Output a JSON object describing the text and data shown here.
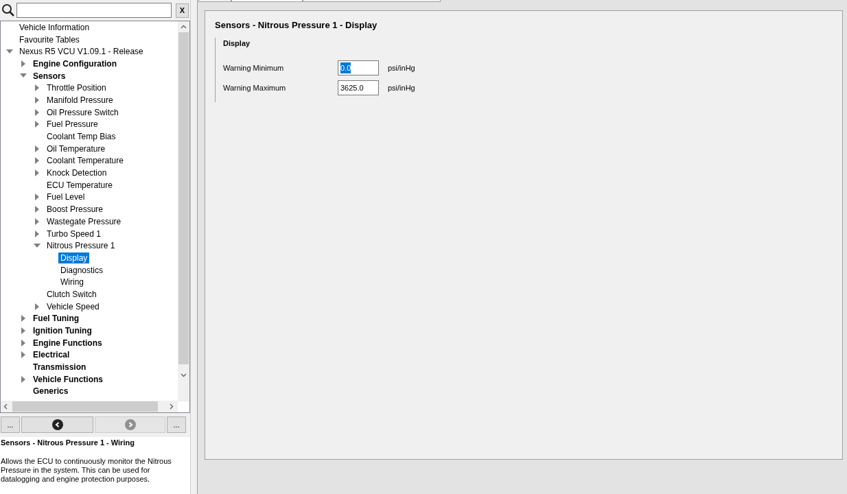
{
  "search": {
    "clear_button": "X"
  },
  "tree": [
    {
      "label": "Vehicle Information",
      "selected": false
    },
    {
      "label": "Favourite Tables",
      "selected": false
    },
    {
      "label": "Nexus R5 VCU V1.09.1 - Release",
      "selected": false,
      "expanded": true,
      "children": [
        {
          "label": "Engine Configuration",
          "selected": false,
          "expanded": false
        },
        {
          "label": "Sensors",
          "selected": false,
          "expanded": true,
          "children": [
            {
              "label": "Throttle Position",
              "selected": false,
              "expanded": false
            },
            {
              "label": "Manifold Pressure",
              "selected": false,
              "expanded": false
            },
            {
              "label": "Oil Pressure Switch",
              "selected": false,
              "expanded": false
            },
            {
              "label": "Fuel Pressure",
              "selected": false,
              "expanded": false
            },
            {
              "label": "Coolant Temp Bias",
              "selected": false
            },
            {
              "label": "Oil Temperature",
              "selected": false,
              "expanded": false
            },
            {
              "label": "Coolant Temperature",
              "selected": false,
              "expanded": false
            },
            {
              "label": "Knock Detection",
              "selected": false,
              "expanded": false
            },
            {
              "label": "ECU Temperature",
              "selected": false
            },
            {
              "label": "Fuel Level",
              "selected": false,
              "expanded": false
            },
            {
              "label": "Boost Pressure",
              "selected": false,
              "expanded": false
            },
            {
              "label": "Wastegate Pressure",
              "selected": false,
              "expanded": false
            },
            {
              "label": "Turbo Speed 1",
              "selected": false,
              "expanded": false
            },
            {
              "label": "Nitrous Pressure 1",
              "selected": false,
              "expanded": true,
              "children": [
                {
                  "label": "Display",
                  "selected": true
                },
                {
                  "label": "Diagnostics",
                  "selected": false
                },
                {
                  "label": "Wiring",
                  "selected": false
                }
              ]
            },
            {
              "label": "Clutch Switch",
              "selected": false
            },
            {
              "label": "Vehicle Speed",
              "selected": false,
              "expanded": false
            }
          ]
        },
        {
          "label": "Fuel Tuning",
          "selected": false,
          "expanded": false
        },
        {
          "label": "Ignition Tuning",
          "selected": false,
          "expanded": false
        },
        {
          "label": "Engine Functions",
          "selected": false,
          "expanded": false
        },
        {
          "label": "Electrical",
          "selected": false,
          "expanded": false
        },
        {
          "label": "Transmission",
          "selected": false
        },
        {
          "label": "Vehicle Functions",
          "selected": false,
          "expanded": false
        },
        {
          "label": "Generics",
          "selected": false
        }
      ]
    }
  ],
  "nav": {
    "left_more": "...",
    "right_more": "...",
    "back_disabled": false,
    "forward_disabled": true
  },
  "description": {
    "title": "Sensors - Nitrous Pressure 1 - Wiring",
    "text": "Allows the ECU to continuously monitor the Nitrous Pressure in the system. This can be used for datalogging and engine protection purposes."
  },
  "tabs": [
    {
      "selected": false
    },
    {
      "selected": true
    },
    {
      "selected": false
    }
  ],
  "page": {
    "title": "Sensors - Nitrous Pressure 1 - Display",
    "group": "Display",
    "fields": [
      {
        "label": "Warning Minimum",
        "value": "0.0",
        "text_selected": true,
        "unit": "psi/inHg"
      },
      {
        "label": "Warning Maximum",
        "value": "3625.0",
        "text_selected": false,
        "unit": "psi/inHg"
      }
    ]
  }
}
